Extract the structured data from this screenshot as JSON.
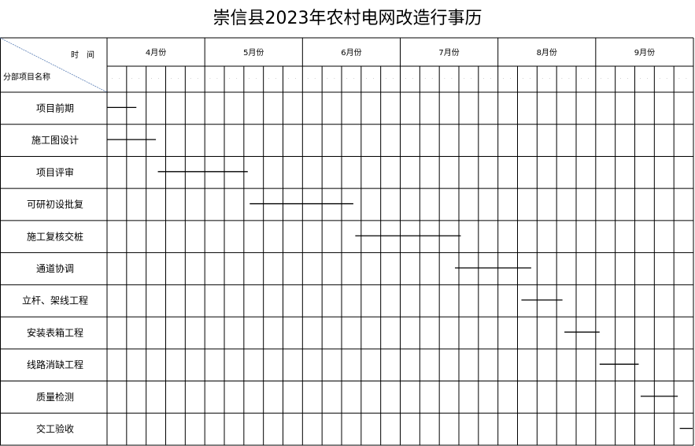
{
  "title": "崇信县2023年农村电网改造行事历",
  "header": {
    "time_label": "时　间",
    "item_label": "分部项目名称"
  },
  "months": [
    "4月份",
    "5月份",
    "6月份",
    "7月份",
    "8月份",
    "9月份"
  ],
  "tasks": [
    {
      "name": "项目前期",
      "start": 0,
      "end": 1.5
    },
    {
      "name": "施工图设计",
      "start": 0,
      "end": 2.5
    },
    {
      "name": "项目评审",
      "start": 2.6,
      "end": 7.2
    },
    {
      "name": "可研初设批复",
      "start": 7.3,
      "end": 12.6
    },
    {
      "name": "施工复核交桩",
      "start": 12.7,
      "end": 18.1
    },
    {
      "name": "通道协调",
      "start": 17.8,
      "end": 21.7
    },
    {
      "name": "立杆、架线工程",
      "start": 21.2,
      "end": 23.3
    },
    {
      "name": "安装表箱工程",
      "start": 23.4,
      "end": 25.2
    },
    {
      "name": "线路消缺工程",
      "start": 25.2,
      "end": 27.2
    },
    {
      "name": "质量检测",
      "start": 27.3,
      "end": 29.2
    },
    {
      "name": "交工验收",
      "start": 29.3,
      "end": 31.1
    }
  ]
}
